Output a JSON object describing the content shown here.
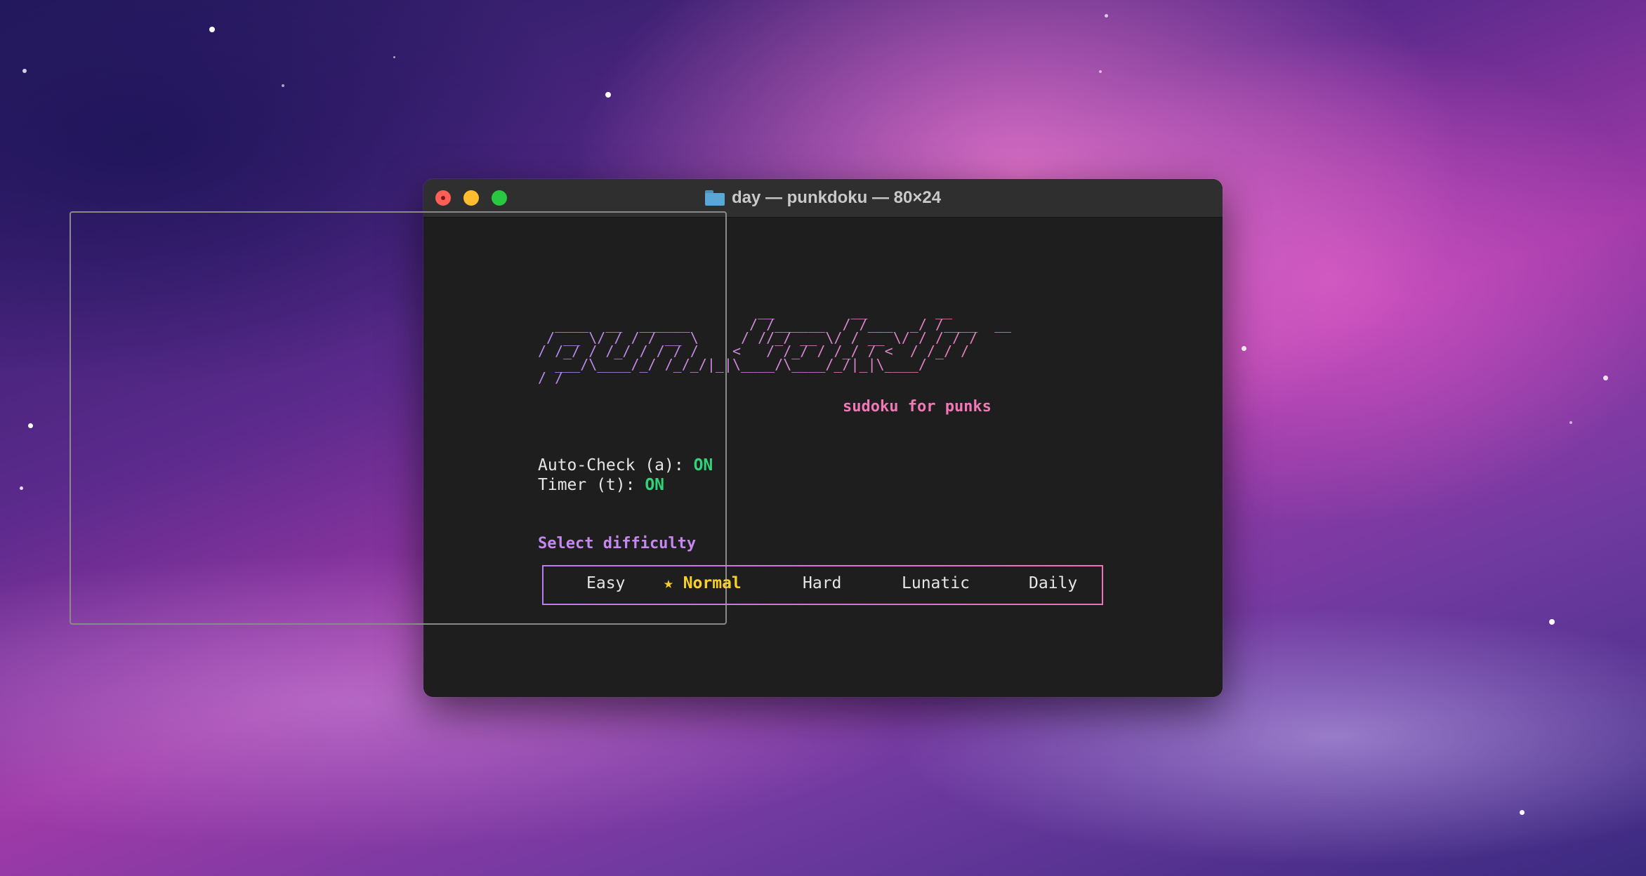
{
  "window": {
    "title": "day — punkdoku — 80×24"
  },
  "logo": {
    "ascii": "                          __         __        __\n  ____  __  ______       / /______  / /___  _/ /____  __\n / __ \\/ / / / __ \\     / //_/ __ \\/ / __ \\/ / / / /\n/ /_/ / /_/ / / / /    <   / /_/ / /_/ / <  / /_/ /\n  ___/\\____/_/ /_/_/|_|\\____/\\____/_/|_|\\____/\n/_/",
    "tagline": "sudoku for punks"
  },
  "settings": {
    "auto_check_label": "Auto-Check (a): ",
    "auto_check_value": "ON",
    "timer_label": "Timer (t): ",
    "timer_value": "ON"
  },
  "difficulty": {
    "label": "Select difficulty",
    "options": [
      "Easy",
      "★ Normal",
      "Hard",
      "Lunatic",
      "Daily"
    ],
    "selected": "Normal"
  },
  "colors": {
    "accent_purple": "#c787f0",
    "accent_pink": "#f178b7",
    "on_green": "#2fd47a",
    "selected_yellow": "#f8cf2a"
  }
}
